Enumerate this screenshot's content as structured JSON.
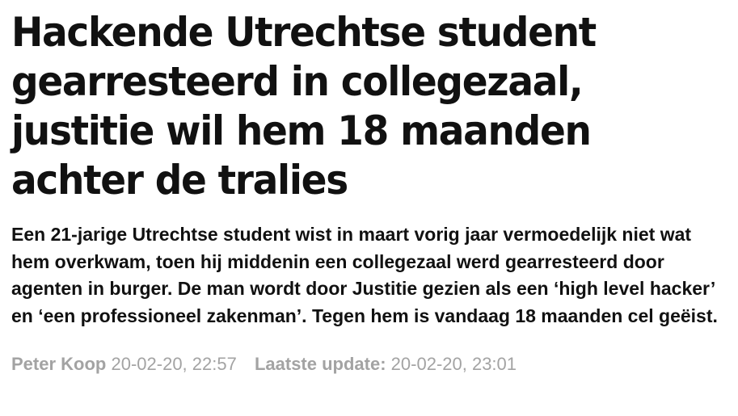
{
  "article": {
    "headline": "Hackende Utrechtse student gearresteerd in collegezaal, justitie wil hem 18 maanden achter de tralies",
    "intro": "Een 21-jarige Utrechtse student wist in maart vorig jaar vermoedelijk niet wat hem overkwam, toen hij middenin een collegezaal werd gearresteerd door agenten in burger. De man wordt door Justitie gezien als een ‘high level hacker’ en ‘een professioneel zakenman’. Tegen hem is vandaag 18 maanden cel geëist.",
    "meta": {
      "author": "Peter Koop",
      "published": "20-02-20, 22:57",
      "update_label": "Laatste update:",
      "updated": "20-02-20, 23:01"
    }
  },
  "colors": {
    "text": "#111111",
    "meta": "#a3a3a3",
    "background": "#ffffff"
  }
}
